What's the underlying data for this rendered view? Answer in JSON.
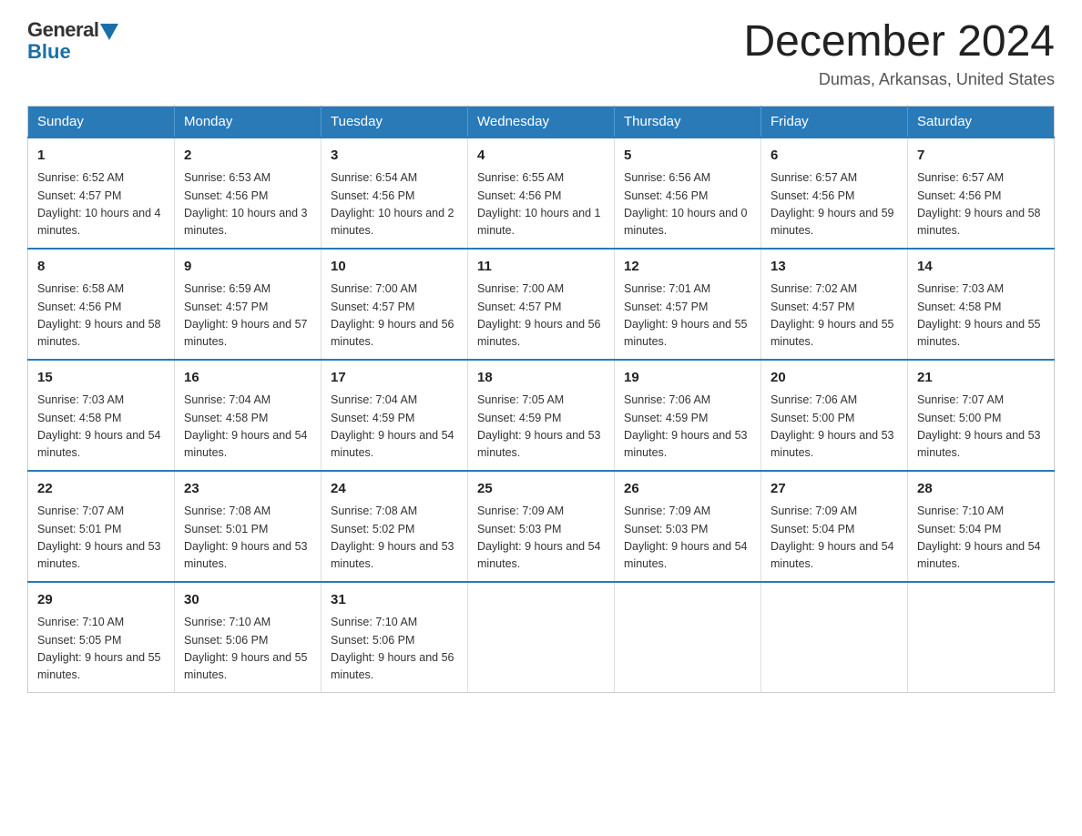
{
  "header": {
    "logo_general": "General",
    "logo_blue": "Blue",
    "month_title": "December 2024",
    "location": "Dumas, Arkansas, United States"
  },
  "days_of_week": [
    "Sunday",
    "Monday",
    "Tuesday",
    "Wednesday",
    "Thursday",
    "Friday",
    "Saturday"
  ],
  "weeks": [
    [
      {
        "day": "1",
        "sunrise": "6:52 AM",
        "sunset": "4:57 PM",
        "daylight": "10 hours and 4 minutes."
      },
      {
        "day": "2",
        "sunrise": "6:53 AM",
        "sunset": "4:56 PM",
        "daylight": "10 hours and 3 minutes."
      },
      {
        "day": "3",
        "sunrise": "6:54 AM",
        "sunset": "4:56 PM",
        "daylight": "10 hours and 2 minutes."
      },
      {
        "day": "4",
        "sunrise": "6:55 AM",
        "sunset": "4:56 PM",
        "daylight": "10 hours and 1 minute."
      },
      {
        "day": "5",
        "sunrise": "6:56 AM",
        "sunset": "4:56 PM",
        "daylight": "10 hours and 0 minutes."
      },
      {
        "day": "6",
        "sunrise": "6:57 AM",
        "sunset": "4:56 PM",
        "daylight": "9 hours and 59 minutes."
      },
      {
        "day": "7",
        "sunrise": "6:57 AM",
        "sunset": "4:56 PM",
        "daylight": "9 hours and 58 minutes."
      }
    ],
    [
      {
        "day": "8",
        "sunrise": "6:58 AM",
        "sunset": "4:56 PM",
        "daylight": "9 hours and 58 minutes."
      },
      {
        "day": "9",
        "sunrise": "6:59 AM",
        "sunset": "4:57 PM",
        "daylight": "9 hours and 57 minutes."
      },
      {
        "day": "10",
        "sunrise": "7:00 AM",
        "sunset": "4:57 PM",
        "daylight": "9 hours and 56 minutes."
      },
      {
        "day": "11",
        "sunrise": "7:00 AM",
        "sunset": "4:57 PM",
        "daylight": "9 hours and 56 minutes."
      },
      {
        "day": "12",
        "sunrise": "7:01 AM",
        "sunset": "4:57 PM",
        "daylight": "9 hours and 55 minutes."
      },
      {
        "day": "13",
        "sunrise": "7:02 AM",
        "sunset": "4:57 PM",
        "daylight": "9 hours and 55 minutes."
      },
      {
        "day": "14",
        "sunrise": "7:03 AM",
        "sunset": "4:58 PM",
        "daylight": "9 hours and 55 minutes."
      }
    ],
    [
      {
        "day": "15",
        "sunrise": "7:03 AM",
        "sunset": "4:58 PM",
        "daylight": "9 hours and 54 minutes."
      },
      {
        "day": "16",
        "sunrise": "7:04 AM",
        "sunset": "4:58 PM",
        "daylight": "9 hours and 54 minutes."
      },
      {
        "day": "17",
        "sunrise": "7:04 AM",
        "sunset": "4:59 PM",
        "daylight": "9 hours and 54 minutes."
      },
      {
        "day": "18",
        "sunrise": "7:05 AM",
        "sunset": "4:59 PM",
        "daylight": "9 hours and 53 minutes."
      },
      {
        "day": "19",
        "sunrise": "7:06 AM",
        "sunset": "4:59 PM",
        "daylight": "9 hours and 53 minutes."
      },
      {
        "day": "20",
        "sunrise": "7:06 AM",
        "sunset": "5:00 PM",
        "daylight": "9 hours and 53 minutes."
      },
      {
        "day": "21",
        "sunrise": "7:07 AM",
        "sunset": "5:00 PM",
        "daylight": "9 hours and 53 minutes."
      }
    ],
    [
      {
        "day": "22",
        "sunrise": "7:07 AM",
        "sunset": "5:01 PM",
        "daylight": "9 hours and 53 minutes."
      },
      {
        "day": "23",
        "sunrise": "7:08 AM",
        "sunset": "5:01 PM",
        "daylight": "9 hours and 53 minutes."
      },
      {
        "day": "24",
        "sunrise": "7:08 AM",
        "sunset": "5:02 PM",
        "daylight": "9 hours and 53 minutes."
      },
      {
        "day": "25",
        "sunrise": "7:09 AM",
        "sunset": "5:03 PM",
        "daylight": "9 hours and 54 minutes."
      },
      {
        "day": "26",
        "sunrise": "7:09 AM",
        "sunset": "5:03 PM",
        "daylight": "9 hours and 54 minutes."
      },
      {
        "day": "27",
        "sunrise": "7:09 AM",
        "sunset": "5:04 PM",
        "daylight": "9 hours and 54 minutes."
      },
      {
        "day": "28",
        "sunrise": "7:10 AM",
        "sunset": "5:04 PM",
        "daylight": "9 hours and 54 minutes."
      }
    ],
    [
      {
        "day": "29",
        "sunrise": "7:10 AM",
        "sunset": "5:05 PM",
        "daylight": "9 hours and 55 minutes."
      },
      {
        "day": "30",
        "sunrise": "7:10 AM",
        "sunset": "5:06 PM",
        "daylight": "9 hours and 55 minutes."
      },
      {
        "day": "31",
        "sunrise": "7:10 AM",
        "sunset": "5:06 PM",
        "daylight": "9 hours and 56 minutes."
      },
      null,
      null,
      null,
      null
    ]
  ]
}
